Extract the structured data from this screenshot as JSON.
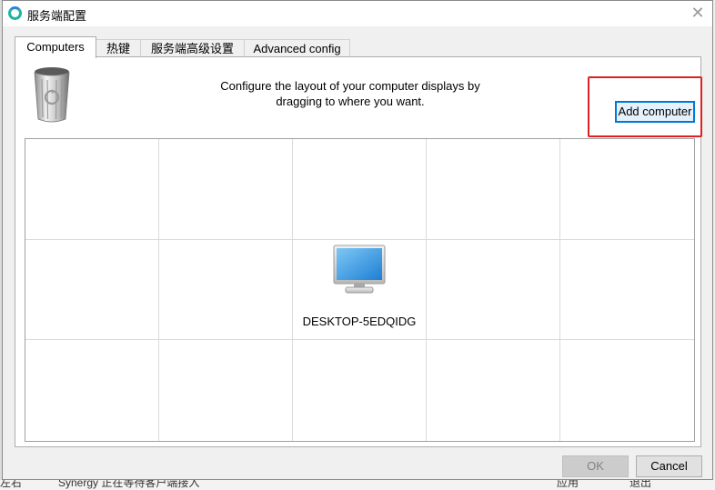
{
  "window": {
    "title": "服务端配置"
  },
  "tabs": [
    {
      "label": "Computers",
      "active": true
    },
    {
      "label": "热键",
      "active": false
    },
    {
      "label": "服务端高级设置",
      "active": false
    },
    {
      "label": "Advanced config",
      "active": false
    }
  ],
  "panel": {
    "instructions_line1": "Configure the layout of your computer displays by",
    "instructions_line2": "dragging to where you want.",
    "add_computer_label": "Add computer",
    "computer_name": "DESKTOP-5EDQIDG"
  },
  "footer": {
    "ok_label": "OK",
    "cancel_label": "Cancel",
    "ok_enabled": false
  },
  "background": {
    "text_left": "左右",
    "text_mid": "Synergy 正在等待客户端接入",
    "text_r1": "应用",
    "text_r2": "退出"
  },
  "colors": {
    "highlight": "#e02020",
    "focus": "#0078d7",
    "app_icon": "#1fb4a0"
  }
}
